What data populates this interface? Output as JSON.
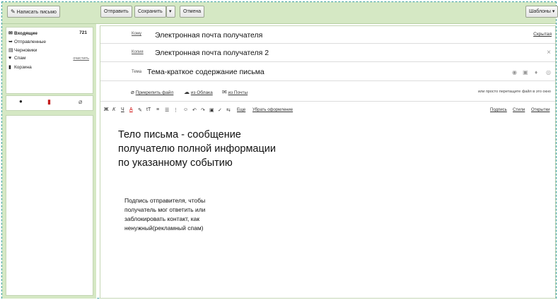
{
  "toolbar": {
    "compose": "Написать письмо",
    "send": "Отправить",
    "save": "Сохранить",
    "save_menu": "▾",
    "cancel": "Отмена",
    "templates": "Шаблоны ▾"
  },
  "folders": [
    {
      "icon": "inbox-icon",
      "glyph": "✉",
      "label": "Входящие",
      "count": "721",
      "bold": true
    },
    {
      "icon": "sent-icon",
      "glyph": "➥",
      "label": "Отправленные"
    },
    {
      "icon": "drafts-icon",
      "glyph": "▤",
      "label": "Черновики"
    },
    {
      "icon": "spam-icon",
      "glyph": "♥",
      "label": "Спам",
      "action": "очистить"
    },
    {
      "icon": "trash-icon",
      "glyph": "▮",
      "label": "Корзина"
    }
  ],
  "compose": {
    "to_label": "Кому",
    "to_value": "Электронная почта получателя",
    "hide_link": "Скрытая",
    "cc_label": "Копия",
    "cc_value": "Электронная почта получателя 2",
    "cc_remove": "×",
    "subject_label": "Тема",
    "subject_value": "Тема-краткое содержание письма",
    "attach_file": "Прикрепить файл",
    "from_cloud": "из Облака",
    "from_mail": "из Почты",
    "drop_hint": "или просто перетащите файл в это окно"
  },
  "format": {
    "more": "Еще",
    "clear": "Убрать оформление",
    "signature": "Подпись",
    "styles": "Стили",
    "postcards": "Открытки"
  },
  "body": {
    "main": "Тело письма - сообщение\nполучателю полной информации\nпо указанному событию",
    "signature": "Подпись отправителя, чтобы\nполучатель мог ответить или\nзаблокировать контакт, как\nненужный(рекламный спам)"
  }
}
